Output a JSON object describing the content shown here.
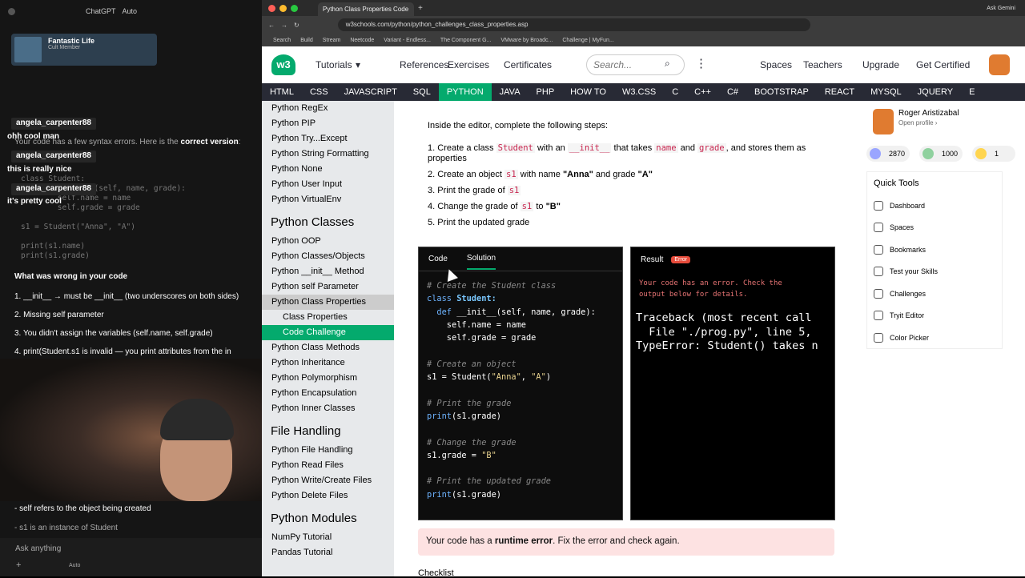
{
  "left": {
    "app": "ChatGPT",
    "app_mode": "Auto",
    "music": {
      "title": "Fantastic Life",
      "subtitle": "Cult Member"
    },
    "chat": [
      {
        "user": "angela_carpenter88",
        "msg": "ohh cool man"
      },
      {
        "user": "angela_carpenter88",
        "msg": "this is really nice"
      },
      {
        "user": "angela_carpenter88",
        "msg": "it's pretty cool"
      }
    ],
    "gpt_intro_a": "Your code has a few syntax errors. Here is the ",
    "gpt_intro_b": "correct version",
    "gpt_intro_c": ":",
    "code_lines": "class Student:\n    def __init__(self, name, grade):\n        self.name = name\n        self.grade = grade\n\ns1 = Student(\"Anna\", \"A\")\n\nprint(s1.name)\nprint(s1.grade)",
    "wrong_heading": "What was wrong in your code",
    "points": [
      "1. __init__ → must be __init__ (two underscores on both sides)",
      "2. Missing self parameter",
      "3. You didn't assign the variables (self.name, self.grade)",
      "4. print(Student.s1 is invalid — you print attributes from the in"
    ],
    "bottom1": "- self refers to the object being created",
    "bottom2": "- s1 is an instance of Student",
    "ask_placeholder": "Ask anything",
    "ask_auto": "Auto"
  },
  "browser": {
    "tab_title": "Python Class Properties Code",
    "url": "w3schools.com/python/python_challenges_class_properties.asp",
    "ask_gemini": "Ask Gemini",
    "bookmarks": [
      "Search",
      "Build",
      "Stream",
      "Neetcode",
      "Variant - Endless...",
      "The Component G...",
      "VMware by Broadc...",
      "Challenge | MyFun..."
    ]
  },
  "w3": {
    "logo": "w3",
    "nav": [
      "Tutorials",
      "References",
      "Exercises",
      "Certificates"
    ],
    "search_placeholder": "Search...",
    "right_links": [
      "Spaces",
      "Teachers",
      "Upgrade",
      "Get Certified"
    ],
    "topnav": [
      "HTML",
      "CSS",
      "JAVASCRIPT",
      "SQL",
      "PYTHON",
      "JAVA",
      "PHP",
      "HOW TO",
      "W3.CSS",
      "C",
      "C++",
      "C#",
      "BOOTSTRAP",
      "REACT",
      "MYSQL",
      "JQUERY",
      "E"
    ],
    "sidebar_top": [
      "Python RegEx",
      "Python PIP",
      "Python Try...Except",
      "Python String Formatting",
      "Python None",
      "Python User Input",
      "Python VirtualEnv"
    ],
    "sidebar_classes_title": "Python Classes",
    "sidebar_classes": [
      "Python OOP",
      "Python Classes/Objects",
      "Python __init__ Method",
      "Python self Parameter",
      "Python Class Properties"
    ],
    "sidebar_sub": [
      "Class Properties",
      "Code Challenge"
    ],
    "sidebar_classes2": [
      "Python Class Methods",
      "Python Inheritance",
      "Python Polymorphism",
      "Python Encapsulation",
      "Python Inner Classes"
    ],
    "sidebar_file_title": "File Handling",
    "sidebar_file": [
      "Python File Handling",
      "Python Read Files",
      "Python Write/Create Files",
      "Python Delete Files"
    ],
    "sidebar_modules_title": "Python Modules",
    "sidebar_modules": [
      "NumPy Tutorial",
      "Pandas Tutorial"
    ],
    "steps_intro": "Inside the editor, complete the following steps:",
    "steps": {
      "s1a": "Create a class ",
      "s1b": "Student",
      "s1c": " with an ",
      "s1d": "__init__",
      "s1e": " that takes ",
      "s1f": "name",
      "s1g": " and ",
      "s1h": "grade",
      "s1i": ", and stores them as properties",
      "s2a": "Create an object ",
      "s2b": "s1",
      "s2c": " with name ",
      "s2d": "\"Anna\"",
      "s2e": " and grade ",
      "s2f": "\"A\"",
      "s3a": "Print the grade of ",
      "s3b": "s1",
      "s4a": "Change the grade of ",
      "s4b": "s1",
      "s4c": " to ",
      "s4d": "\"B\"",
      "s5": "Print the updated grade",
      "n1": "1.",
      "n2": "2.",
      "n3": "3.",
      "n4": "4.",
      "n5": "5."
    },
    "editor_tabs": [
      "Code",
      "Solution"
    ],
    "editor": {
      "c1": "# Create the Student class",
      "l2k": "class",
      "l2n": " Student:",
      "l3k": "  def",
      "l3f": " __init__",
      "l3r": "(self, name, grade):",
      "l4": "    self.name = name",
      "l5": "    self.grade = grade",
      "c2": "# Create an object",
      "l7a": "s1 = Student(",
      "l7s1": "\"Anna\"",
      "l7b": ", ",
      "l7s2": "\"A\"",
      "l7c": ")",
      "c3": "# Print the grade",
      "l9k": "print",
      "l9r": "(s1.grade)",
      "c4": "# Change the grade",
      "l11a": "s1.grade = ",
      "l11s": "\"B\"",
      "c5": "# Print the updated grade",
      "l13k": "print",
      "l13r": "(s1.grade)"
    },
    "result_tab": "Result",
    "result_badge": "Error",
    "result_msg": "Your code has an error. Check the\noutput below for details.",
    "traceback": "Traceback (most recent call\n  File \"./prog.py\", line 5,\nTypeError: Student() takes n",
    "runtime_a": "Your code has a ",
    "runtime_b": "runtime error",
    "runtime_c": ". Fix the error and check again.",
    "checklist": "Checklist",
    "profile_name": "Roger Aristizabal",
    "profile_link": "Open profile ›",
    "badges": [
      "2870",
      "1000",
      "1"
    ],
    "quick_tools_title": "Quick Tools",
    "quick_tools": [
      "Dashboard",
      "Spaces",
      "Bookmarks",
      "Test your Skills",
      "Challenges",
      "Tryit Editor",
      "Color Picker"
    ]
  }
}
